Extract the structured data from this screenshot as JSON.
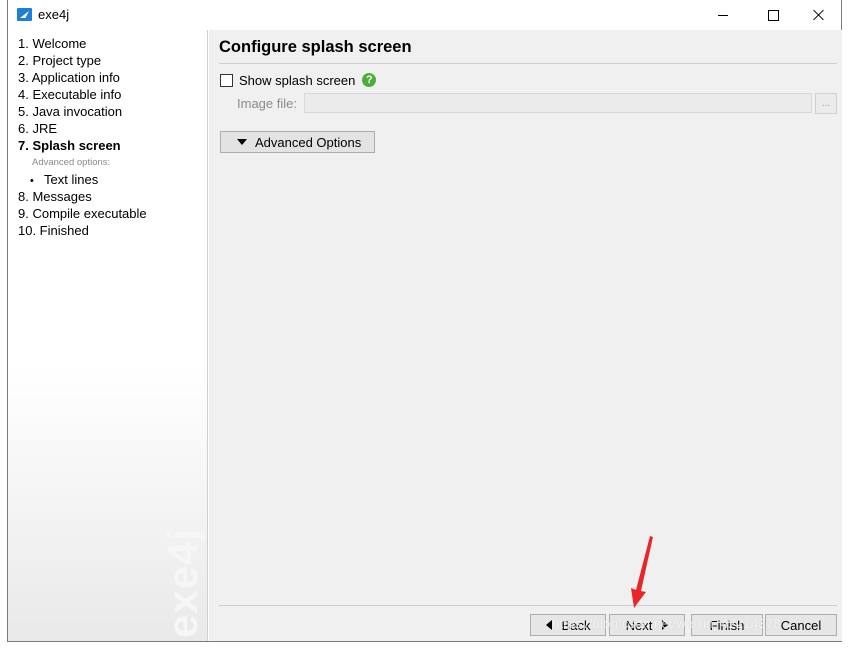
{
  "window": {
    "title": "exe4j",
    "controls": {
      "minimize": "minimize",
      "maximize": "maximize",
      "close": "close"
    }
  },
  "sidebar": {
    "steps": [
      {
        "label": "1. Welcome",
        "current": false
      },
      {
        "label": "2. Project type",
        "current": false
      },
      {
        "label": "3. Application info",
        "current": false
      },
      {
        "label": "4. Executable info",
        "current": false
      },
      {
        "label": "5. Java invocation",
        "current": false
      },
      {
        "label": "6. JRE",
        "current": false
      },
      {
        "label": "7. Splash screen",
        "current": true
      }
    ],
    "advanced_heading": "Advanced options:",
    "advanced_items": [
      "Text lines"
    ],
    "steps_after": [
      {
        "label": "8. Messages"
      },
      {
        "label": "9. Compile executable"
      },
      {
        "label": "10. Finished"
      }
    ],
    "watermark": "exe4j"
  },
  "page": {
    "title": "Configure splash screen",
    "show_splash_label": "Show splash screen",
    "show_splash_checked": false,
    "help_icon_glyph": "?",
    "image_file_label": "Image file:",
    "image_file_value": "",
    "browse_label": "...",
    "advanced_button_label": "Advanced Options"
  },
  "footer": {
    "back_label": "Back",
    "next_label": "Next",
    "finish_label": "Finish",
    "cancel_label": "Cancel"
  },
  "overlay": {
    "watermark_url": "https://blog.csdn.net/weixin_42214378",
    "arrow_color": "#e8262a"
  },
  "colors": {
    "content_bg": "#f0f0f0",
    "help_icon": "#4caf3c",
    "disabled_text": "#8a8a8a"
  }
}
